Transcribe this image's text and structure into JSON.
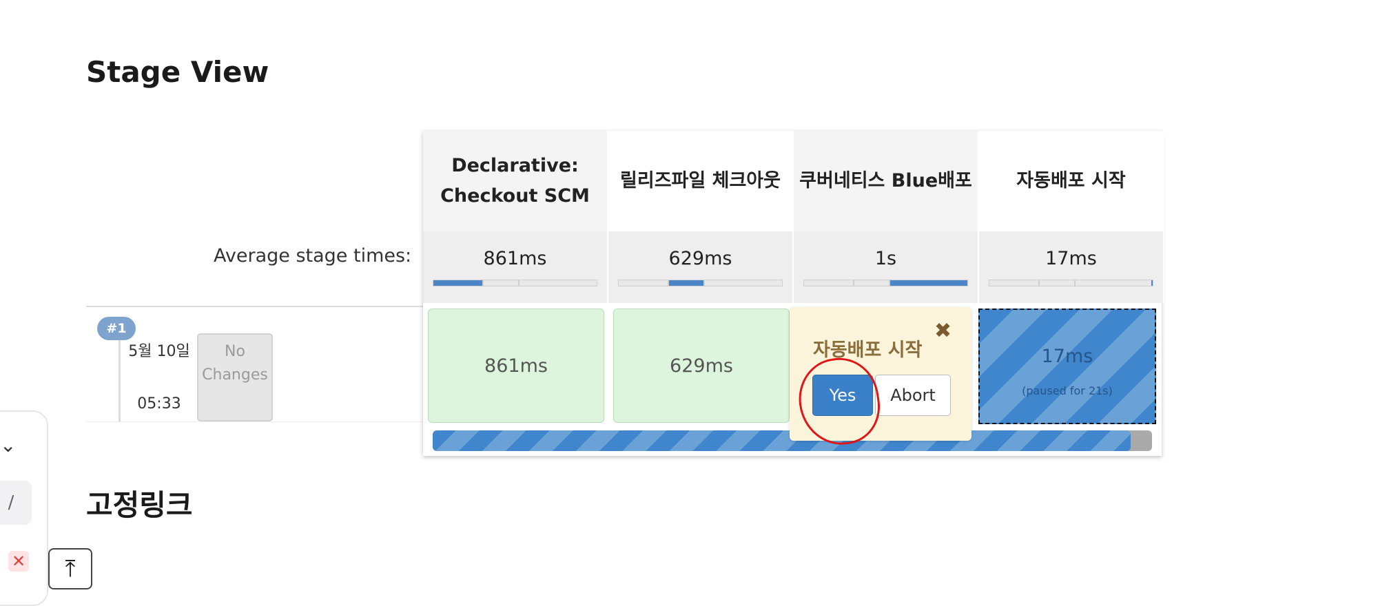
{
  "section_title": "Stage View",
  "footer_title": "고정링크",
  "average_label": "Average stage times:",
  "stages": [
    {
      "name": "Declarative: Checkout SCM",
      "avg": "861ms",
      "run": "861ms"
    },
    {
      "name": "릴리즈파일 체크아웃",
      "avg": "629ms",
      "run": "629ms"
    },
    {
      "name": "쿠버네티스 Blue배포",
      "avg": "1s",
      "run": ""
    },
    {
      "name": "자동배포 시작",
      "avg": "17ms",
      "run": "17ms",
      "run_sub": "(paused for 21s)"
    }
  ],
  "build": {
    "badge": "#1",
    "date": "5월 10일",
    "time": "05:33",
    "changes": "No Changes"
  },
  "popover": {
    "title": "자동배포 시작",
    "yes": "Yes",
    "abort": "Abort",
    "close_icon": "close-icon"
  },
  "side": {
    "slash": "/",
    "close": "✕",
    "scroll_top": "⤒"
  },
  "colors": {
    "success_bg": "#dcf5dc",
    "paused_blue": "#3f86cc",
    "popover_bg": "#fcf5dc",
    "annotation_red": "#e01515"
  }
}
